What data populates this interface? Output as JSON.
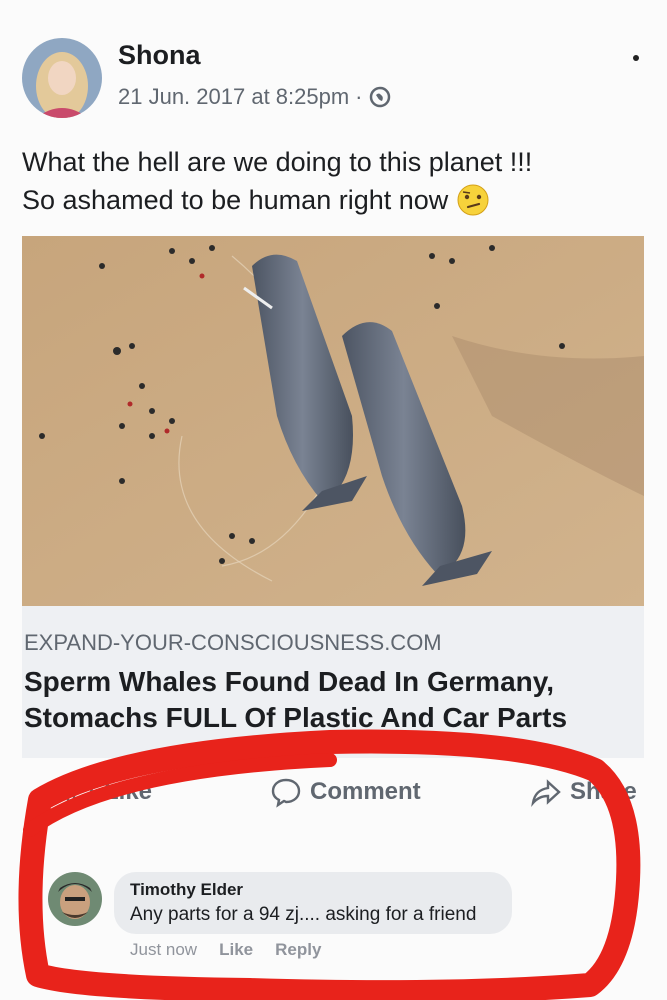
{
  "post": {
    "author": "Shona",
    "timestamp": "21 Jun. 2017 at 8:25pm",
    "separator": "·",
    "text_line1": "What the hell are we doing to this planet !!!",
    "text_line2": "So ashamed to be human right now",
    "emoji": "confused-face-icon"
  },
  "link": {
    "domain": "EXPAND-YOUR-CONSCIOUSNESS.COM",
    "title": "Sperm Whales Found Dead In Germany, Stomachs FULL Of Plastic And Car Parts"
  },
  "actions": {
    "like": "Like",
    "comment": "Comment",
    "share": "Share"
  },
  "comment": {
    "author": "Timothy Elder",
    "text": "Any parts for a 94 zj.... asking for a friend",
    "time": "Just now",
    "like": "Like",
    "reply": "Reply"
  },
  "colors": {
    "sand": "#c9a981",
    "whale": "#5e6674",
    "annotation": "#e8231b",
    "secondary_text": "#606770"
  }
}
